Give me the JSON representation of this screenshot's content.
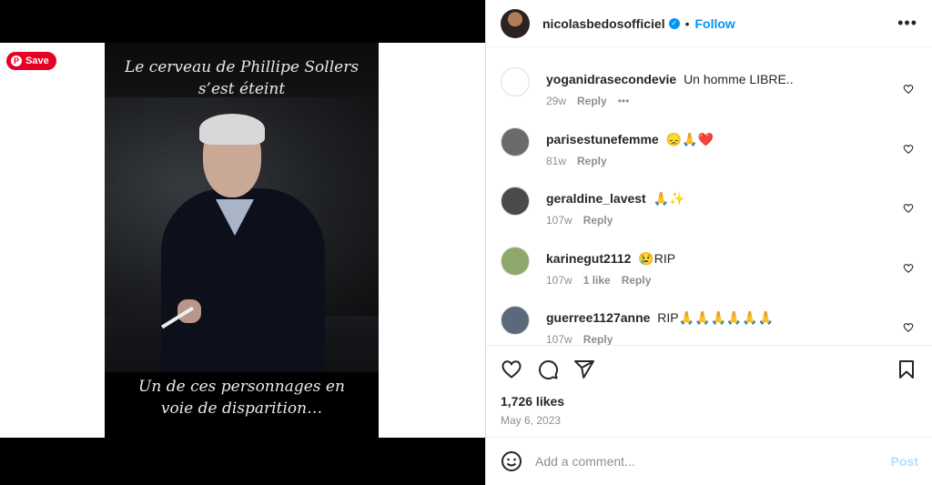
{
  "media": {
    "caption_top_line1": "Le cerveau de Phillipe Sollers",
    "caption_top_line2": "s’est éteint",
    "caption_bottom_line1": "Un de ces personnages en",
    "caption_bottom_line2": "voie de disparition…",
    "pinterest_save": "Save"
  },
  "header": {
    "username": "nicolasbedosofficiel",
    "follow_label": "Follow",
    "more_icon": "ellipsis-icon"
  },
  "comments": [
    {
      "user": "yoganidrasecondevie",
      "text": "Un homme LIBRE..",
      "age": "29w",
      "likes": "",
      "reply": "Reply",
      "more": "•••",
      "avatar_color": "#ffffff"
    },
    {
      "user": "parisestunefemme",
      "text": "😞🙏❤️",
      "age": "81w",
      "likes": "",
      "reply": "Reply",
      "more": "",
      "avatar_color": "#6b6b6b"
    },
    {
      "user": "geraldine_lavest",
      "text": "🙏✨",
      "age": "107w",
      "likes": "",
      "reply": "Reply",
      "more": "",
      "avatar_color": "#4a4a4a"
    },
    {
      "user": "karinegut2112",
      "text": "😢RIP",
      "age": "107w",
      "likes": "1 like",
      "reply": "Reply",
      "more": "",
      "avatar_color": "#8fa86b"
    },
    {
      "user": "guerree1127anne",
      "text": "RIP🙏🙏🙏🙏🙏🙏",
      "age": "107w",
      "likes": "",
      "reply": "Reply",
      "more": "",
      "avatar_color": "#5a6a7a"
    }
  ],
  "post": {
    "likes": "1,726 likes",
    "date": "May 6, 2023"
  },
  "composer": {
    "placeholder": "Add a comment...",
    "post_label": "Post"
  },
  "colors": {
    "accent": "#0095f6",
    "pinterest": "#e60023"
  }
}
